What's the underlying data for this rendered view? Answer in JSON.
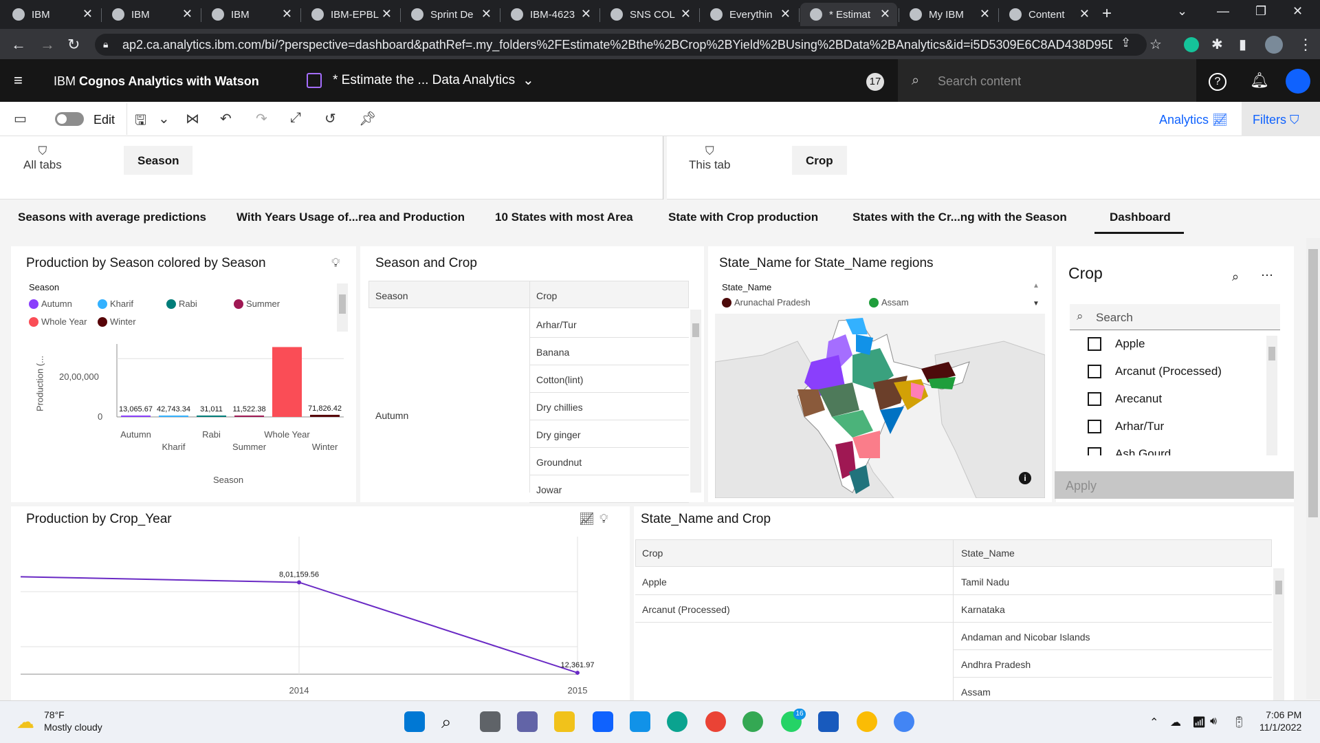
{
  "browser": {
    "tabs": [
      {
        "title": "IBM"
      },
      {
        "title": "IBM"
      },
      {
        "title": "IBM"
      },
      {
        "title": "IBM-EPBL"
      },
      {
        "title": "Sprint De"
      },
      {
        "title": "IBM-4623"
      },
      {
        "title": "SNS COL"
      },
      {
        "title": "Everythin"
      },
      {
        "title": "* Estimat"
      },
      {
        "title": "My IBM"
      },
      {
        "title": "Content"
      }
    ],
    "active_tab": 8,
    "new_tab_glyph": "+",
    "url": "ap2.ca.analytics.ibm.com/bi/?perspective=dashboard&pathRef=.my_folders%2FEstimate%2Bthe%2BCrop%2BYield%2BUsing%2BData%2BAnalytics&id=i5D5309E6C8AD438D95D318E1C..."
  },
  "app": {
    "name_prefix": "IBM ",
    "name_bold": "Cognos Analytics with Watson",
    "dashboard_title": "* Estimate the ... Data Analytics",
    "notification_count": "17",
    "search_placeholder": "Search content"
  },
  "toolbar": {
    "edit_label": "Edit",
    "analytics_label": "Analytics",
    "filters_label": "Filters"
  },
  "filters": {
    "all_tabs_label": "All tabs",
    "all_tabs_chip": "Season",
    "this_tab_label": "This tab",
    "this_tab_chip": "Crop"
  },
  "page_tabs": [
    "Seasons with average predictions",
    "With Years Usage of...rea and Production",
    "10 States with most Area",
    "State with Crop production",
    "States with  the Cr...ng with the Season",
    "Dashboard"
  ],
  "panels": {
    "season_chart": {
      "title": "Production by Season colored by Season",
      "legend_title": "Season",
      "ylabel": "Production (...",
      "xlabel": "Season",
      "ytick_top": "20,00,000",
      "ytick_zero": "0"
    },
    "season_crop_table": {
      "title": "Season and Crop",
      "col_season": "Season",
      "col_crop": "Crop",
      "season_value": "Autumn",
      "crops": [
        "Arhar/Tur",
        "Banana",
        "Cotton(lint)",
        "Dry chillies",
        "Dry ginger",
        "Groundnut",
        "Jowar"
      ]
    },
    "map": {
      "title": "State_Name for State_Name regions",
      "legend_title": "State_Name",
      "legend": [
        {
          "name": "Arunachal Pradesh",
          "color": "#4d0b0b"
        },
        {
          "name": "Assam",
          "color": "#1f9e3c"
        }
      ],
      "info_glyph": "i"
    },
    "crop_filter": {
      "title": "Crop",
      "search_placeholder": "Search",
      "items": [
        "Apple",
        "Arcanut (Processed)",
        "Arecanut",
        "Arhar/Tur",
        "Ash Gourd"
      ],
      "apply_label": "Apply"
    },
    "year_chart": {
      "title": "Production by Crop_Year"
    },
    "state_crop_table": {
      "title": "State_Name and Crop",
      "col_crop": "Crop",
      "col_state": "State_Name",
      "rows": [
        {
          "crop": "Apple",
          "state": "Tamil Nadu"
        },
        {
          "crop": "Arcanut (Processed)",
          "state": "Karnataka"
        },
        {
          "crop": "",
          "state": "Andaman and Nicobar Islands"
        },
        {
          "crop": "",
          "state": "Andhra Pradesh"
        },
        {
          "crop": "",
          "state": "Assam"
        }
      ]
    }
  },
  "chart_data": [
    {
      "type": "bar",
      "title": "Production by Season colored by Season",
      "xlabel": "Season",
      "ylabel": "Production (...",
      "categories": [
        "Autumn",
        "Kharif",
        "Rabi",
        "Summer",
        "Whole Year",
        "Winter"
      ],
      "values": [
        13065.67,
        42743.34,
        31011,
        11522.38,
        2395011.98,
        71826.42
      ],
      "data_labels": [
        "13,065.67",
        "42,743.34",
        "31,011",
        "11,522.38",
        "23,95,011.98",
        "71,826.42"
      ],
      "colors": [
        "#8a3ffc",
        "#33b1ff",
        "#007d79",
        "#9f1853",
        "#fa4d56",
        "#570408"
      ],
      "ylim": [
        0,
        2500000
      ],
      "legend": "top-left"
    },
    {
      "type": "line",
      "title": "Production by Crop_Year",
      "x": [
        2013,
        2014,
        2015
      ],
      "x_ticks": [
        "2014",
        "2015"
      ],
      "values": [
        850000,
        801159.56,
        12361.97
      ],
      "data_labels": [
        "",
        "8,01,159.56",
        "12,361.97"
      ],
      "color": "#6929c4",
      "ylim": [
        0,
        1200000
      ],
      "grid": true
    }
  ],
  "taskbar": {
    "temperature": "78°F",
    "weather": "Mostly cloudy",
    "time": "7:06 PM",
    "date": "11/1/2022",
    "whatsapp_badge": "16"
  }
}
